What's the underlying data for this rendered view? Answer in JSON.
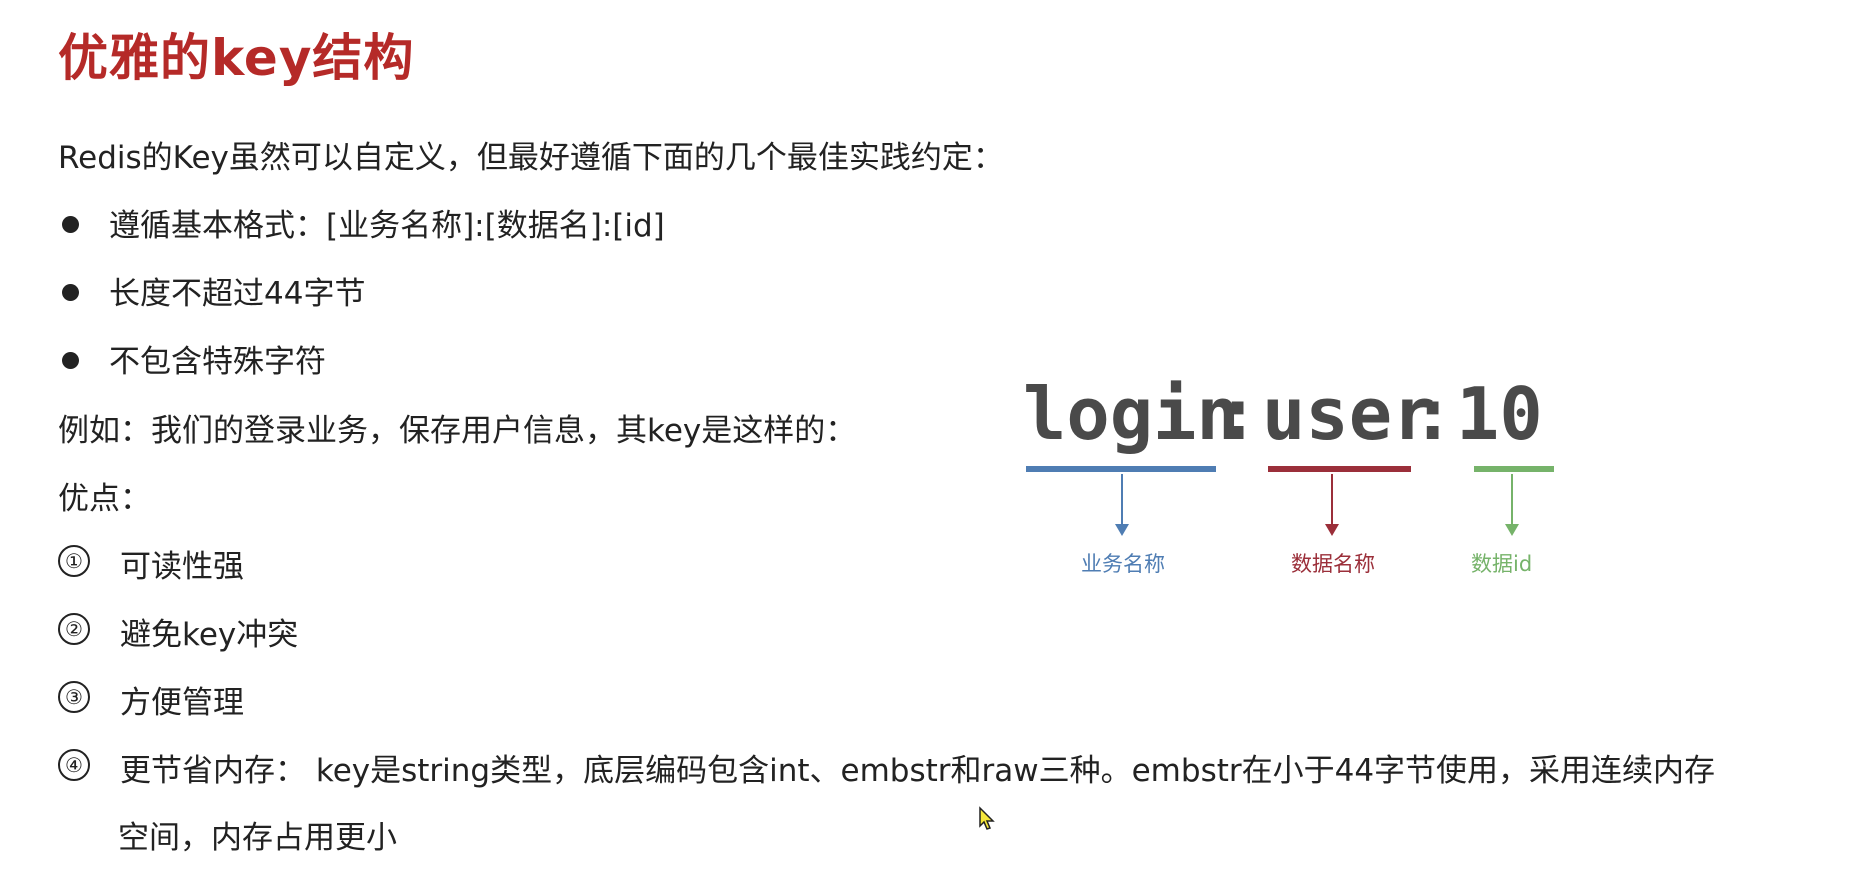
{
  "title": "优雅的key结构",
  "intro": "Redis的Key虽然可以自定义，但最好遵循下面的几个最佳实践约定：",
  "rules": [
    "遵循基本格式：[业务名称]:[数据名]:[id]",
    "长度不超过44字节",
    "不包含特殊字符"
  ],
  "example": "例如：我们的登录业务，保存用户信息，其key是这样的：",
  "advantages_heading": "优点：",
  "advantages": [
    {
      "marker": "①",
      "text": "可读性强"
    },
    {
      "marker": "②",
      "text": "避免key冲突"
    },
    {
      "marker": "③",
      "text": "方便管理"
    },
    {
      "marker": "④",
      "text": "更节省内存： key是string类型，底层编码包含int、embstr和raw三种。embstr在小于44字节使用，采用连续内存",
      "continuation": "空间，内存占用更小"
    }
  ],
  "diagram": {
    "parts": [
      {
        "text": "login",
        "label": "业务名称",
        "color": "#4f7db3"
      },
      {
        "text": "user",
        "label": "数据名称",
        "color": "#9b2f3a"
      },
      {
        "text": "10",
        "label": "数据id",
        "color": "#76b36a"
      }
    ],
    "separator": ":"
  },
  "colors": {
    "title": "#b52a28",
    "text": "#222222"
  }
}
